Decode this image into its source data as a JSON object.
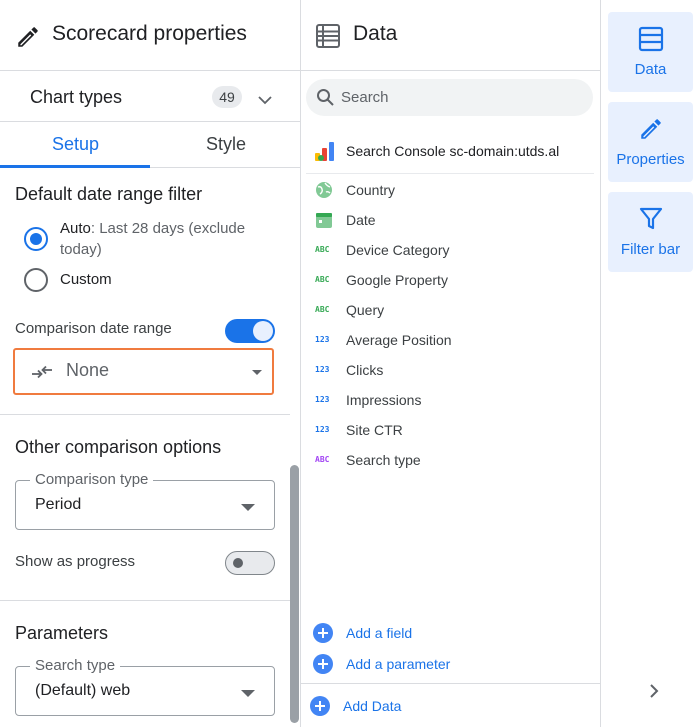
{
  "properties_panel": {
    "title": "Scorecard properties",
    "chart_types": {
      "label": "Chart types",
      "count": "49"
    },
    "tabs": [
      {
        "label": "Setup",
        "active": true
      },
      {
        "label": "Style",
        "active": false
      }
    ],
    "default_date_range": {
      "title": "Default date range filter",
      "auto_label": "Auto",
      "auto_detail": ": Last 28 days (exclude",
      "auto_detail_line2": "today)",
      "custom_label": "Custom",
      "selected": "Auto"
    },
    "comparison_date_range": {
      "label": "Comparison date range",
      "enabled": true,
      "selected_value": "None"
    },
    "other_comparison": {
      "title": "Other comparison options",
      "comparison_type_label": "Comparison type",
      "comparison_type_value": "Period",
      "show_as_progress_label": "Show as progress",
      "show_as_progress_enabled": false
    },
    "parameters": {
      "title": "Parameters",
      "search_type_label": "Search type",
      "search_type_value": "(Default) web"
    }
  },
  "data_panel": {
    "title": "Data",
    "search_placeholder": "Search",
    "source": "Search Console sc-domain:utds.al",
    "fields": [
      {
        "label": "Country",
        "icon": "globe-icon",
        "kind": "dimension"
      },
      {
        "label": "Date",
        "icon": "calendar-icon",
        "kind": "dimension"
      },
      {
        "label": "Device Category",
        "icon": "ABC",
        "kind": "dimension"
      },
      {
        "label": "Google Property",
        "icon": "ABC",
        "kind": "dimension"
      },
      {
        "label": "Query",
        "icon": "ABC",
        "kind": "dimension"
      },
      {
        "label": "Average Position",
        "icon": "123",
        "kind": "metric"
      },
      {
        "label": "Clicks",
        "icon": "123",
        "kind": "metric"
      },
      {
        "label": "Impressions",
        "icon": "123",
        "kind": "metric"
      },
      {
        "label": "Site CTR",
        "icon": "123",
        "kind": "metric"
      },
      {
        "label": "Search type",
        "icon": "ABC",
        "kind": "parameter"
      }
    ],
    "add_field": "Add a field",
    "add_parameter": "Add a parameter",
    "add_data": "Add Data"
  },
  "rail": {
    "data_label": "Data",
    "properties_label": "Properties",
    "filter_bar_label": "Filter bar"
  },
  "colors": {
    "accent": "#1a73e8",
    "highlight_border": "#f07b3f",
    "dimension": "#34a853",
    "metric": "#1a73e8",
    "parameter": "#a142f4"
  }
}
